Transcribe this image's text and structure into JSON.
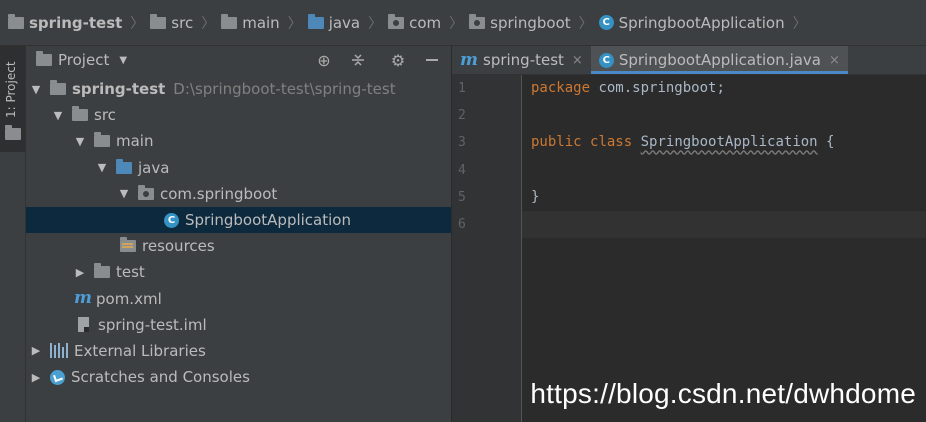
{
  "breadcrumb": {
    "items": [
      {
        "label": "spring-test",
        "icon": "folder-icon"
      },
      {
        "label": "src",
        "icon": "folder-icon"
      },
      {
        "label": "main",
        "icon": "folder-icon"
      },
      {
        "label": "java",
        "icon": "source-folder-icon"
      },
      {
        "label": "com",
        "icon": "package-icon"
      },
      {
        "label": "springboot",
        "icon": "package-icon"
      },
      {
        "label": "SpringbootApplication",
        "icon": "class-icon"
      }
    ]
  },
  "side_strip": {
    "tab_label": "1: Project"
  },
  "project_panel": {
    "title": "Project",
    "tree": [
      {
        "label": "spring-test",
        "path": "D:\\springboot-test\\spring-test"
      },
      {
        "label": "src"
      },
      {
        "label": "main"
      },
      {
        "label": "java"
      },
      {
        "label": "com.springboot"
      },
      {
        "label": "SpringbootApplication"
      },
      {
        "label": "resources"
      },
      {
        "label": "test"
      },
      {
        "label": "pom.xml"
      },
      {
        "label": "spring-test.iml"
      },
      {
        "label": "External Libraries"
      },
      {
        "label": "Scratches and Consoles"
      }
    ]
  },
  "editor": {
    "tabs": [
      {
        "label": "spring-test",
        "close": "×"
      },
      {
        "label": "SpringbootApplication.java",
        "close": "×"
      }
    ],
    "line_numbers": [
      "1",
      "2",
      "3",
      "4",
      "5",
      "6"
    ],
    "code": {
      "line1_kw": "package",
      "line1_rest": " com.springboot;",
      "line3_kw1": "public",
      "line3_kw2": "class",
      "line3_name": "SpringbootApplication",
      "line3_rest": " {",
      "line5": "}"
    }
  },
  "watermark": "https://blog.csdn.net/dwhdome",
  "colors": {
    "accent": "#4a88c7",
    "selection": "#0d293e",
    "keyword": "#cc7832"
  }
}
